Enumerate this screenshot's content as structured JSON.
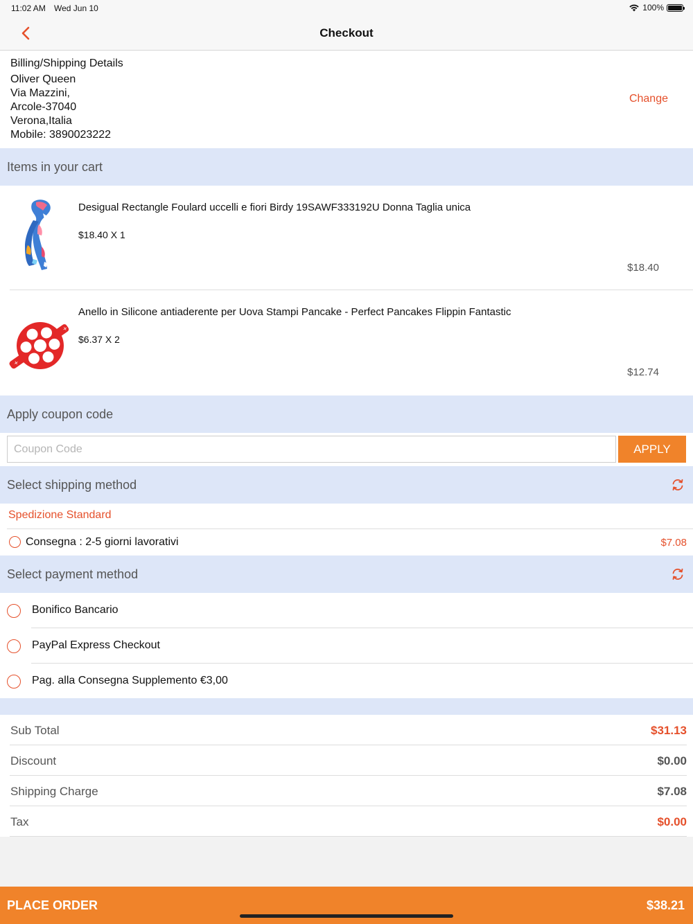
{
  "status_bar": {
    "time": "11:02 AM",
    "date": "Wed Jun 10",
    "battery": "100%"
  },
  "nav": {
    "title": "Checkout"
  },
  "billing": {
    "heading": "Billing/Shipping Details",
    "name": "Oliver Queen",
    "street": "Via Mazzini,",
    "city": "Arcole-37040",
    "region": "Verona,Italia",
    "mobile": "Mobile: 3890023222",
    "change_label": "Change"
  },
  "cart": {
    "title": "Items in your cart",
    "items": [
      {
        "name": "Desigual Rectangle Foulard uccelli e fiori Birdy 19SAWF333192U Donna Taglia unica",
        "qty": "$18.40 X 1",
        "total": "$18.40"
      },
      {
        "name": "Anello in Silicone antiaderente per Uova Stampi Pancake - Perfect Pancakes Flippin Fantastic",
        "qty": "$6.37 X 2",
        "total": "$12.74"
      }
    ]
  },
  "coupon": {
    "title": "Apply coupon code",
    "placeholder": "Coupon Code",
    "apply_label": "APPLY"
  },
  "shipping": {
    "title": "Select shipping method",
    "carrier": "Spedizione Standard",
    "option_label": "Consegna : 2-5 giorni lavorativi",
    "option_price": "$7.08"
  },
  "payment": {
    "title": "Select payment method",
    "options": [
      "Bonifico Bancario",
      "PayPal Express Checkout",
      "Pag. alla Consegna Supplemento €3,00"
    ]
  },
  "summary": {
    "rows": [
      {
        "label": "Sub Total",
        "value": "$31.13"
      },
      {
        "label": "Discount",
        "value": "$0.00"
      },
      {
        "label": "Shipping Charge",
        "value": "$7.08"
      },
      {
        "label": "Tax",
        "value": "$0.00"
      }
    ]
  },
  "place_order": {
    "label": "PLACE ORDER",
    "amount": "$38.21"
  },
  "colors": {
    "accent": "#e5502b",
    "button": "#f0832a",
    "section_bg": "#dde6f8"
  }
}
